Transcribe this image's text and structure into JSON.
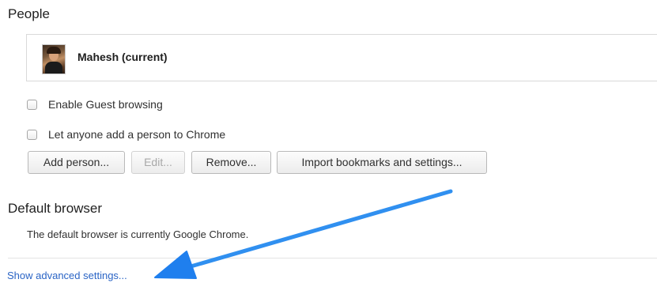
{
  "people": {
    "title": "People",
    "current_profile": "Mahesh (current)",
    "checkboxes": {
      "guest_browsing": "Enable Guest browsing",
      "anyone_add_person": "Let anyone add a person to Chrome"
    },
    "buttons": {
      "add_person": "Add person...",
      "edit": "Edit...",
      "remove": "Remove...",
      "import": "Import bookmarks and settings..."
    }
  },
  "default_browser": {
    "title": "Default browser",
    "status": "The default browser is currently Google Chrome."
  },
  "advanced_link": "Show advanced settings...",
  "icons": {
    "avatar": "user-avatar-photo",
    "annotation_arrow": "arrow-pointer-icon"
  },
  "colors": {
    "link": "#2a64c5",
    "arrow": "#1f8ef0"
  }
}
